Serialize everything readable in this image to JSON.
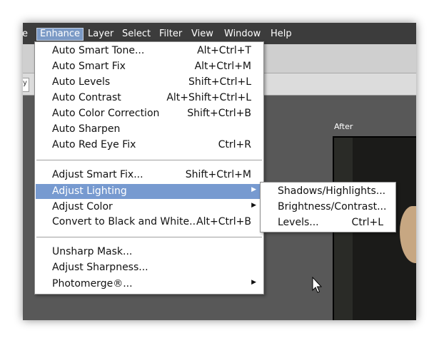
{
  "menubar": {
    "items": [
      {
        "label": "e"
      },
      {
        "label": "Enhance"
      },
      {
        "label": "Layer"
      },
      {
        "label": "Select"
      },
      {
        "label": "Filter"
      },
      {
        "label": "View"
      },
      {
        "label": "Window"
      },
      {
        "label": "Help"
      }
    ]
  },
  "toolbar": {
    "field_fragment": "y"
  },
  "panel": {
    "after_label": "After"
  },
  "enhance_menu": {
    "items": [
      {
        "label": "Auto Smart Tone...",
        "shortcut": "Alt+Ctrl+T"
      },
      {
        "label": "Auto Smart Fix",
        "shortcut": "Alt+Ctrl+M"
      },
      {
        "label": "Auto Levels",
        "shortcut": "Shift+Ctrl+L"
      },
      {
        "label": "Auto Contrast",
        "shortcut": "Alt+Shift+Ctrl+L"
      },
      {
        "label": "Auto Color Correction",
        "shortcut": "Shift+Ctrl+B"
      },
      {
        "label": "Auto Sharpen",
        "shortcut": ""
      },
      {
        "label": "Auto Red Eye Fix",
        "shortcut": "Ctrl+R"
      },
      {
        "label": "Adjust Smart Fix...",
        "shortcut": "Shift+Ctrl+M"
      },
      {
        "label": "Adjust Lighting",
        "shortcut": "",
        "arrow": "▶"
      },
      {
        "label": "Adjust Color",
        "shortcut": "",
        "arrow": "▶"
      },
      {
        "label": "Convert to Black and White...",
        "shortcut": "Alt+Ctrl+B"
      },
      {
        "label": "Unsharp Mask...",
        "shortcut": ""
      },
      {
        "label": "Adjust Sharpness...",
        "shortcut": ""
      },
      {
        "label": "Photomerge®...",
        "shortcut": "",
        "arrow": "▶"
      }
    ]
  },
  "lighting_submenu": {
    "items": [
      {
        "label": "Shadows/Highlights...",
        "shortcut": ""
      },
      {
        "label": "Brightness/Contrast...",
        "shortcut": ""
      },
      {
        "label": "Levels...",
        "shortcut": "Ctrl+L"
      }
    ]
  },
  "colors": {
    "highlight": "#779ad0",
    "menubar": "#3c3c3c",
    "workspace": "#585858"
  }
}
